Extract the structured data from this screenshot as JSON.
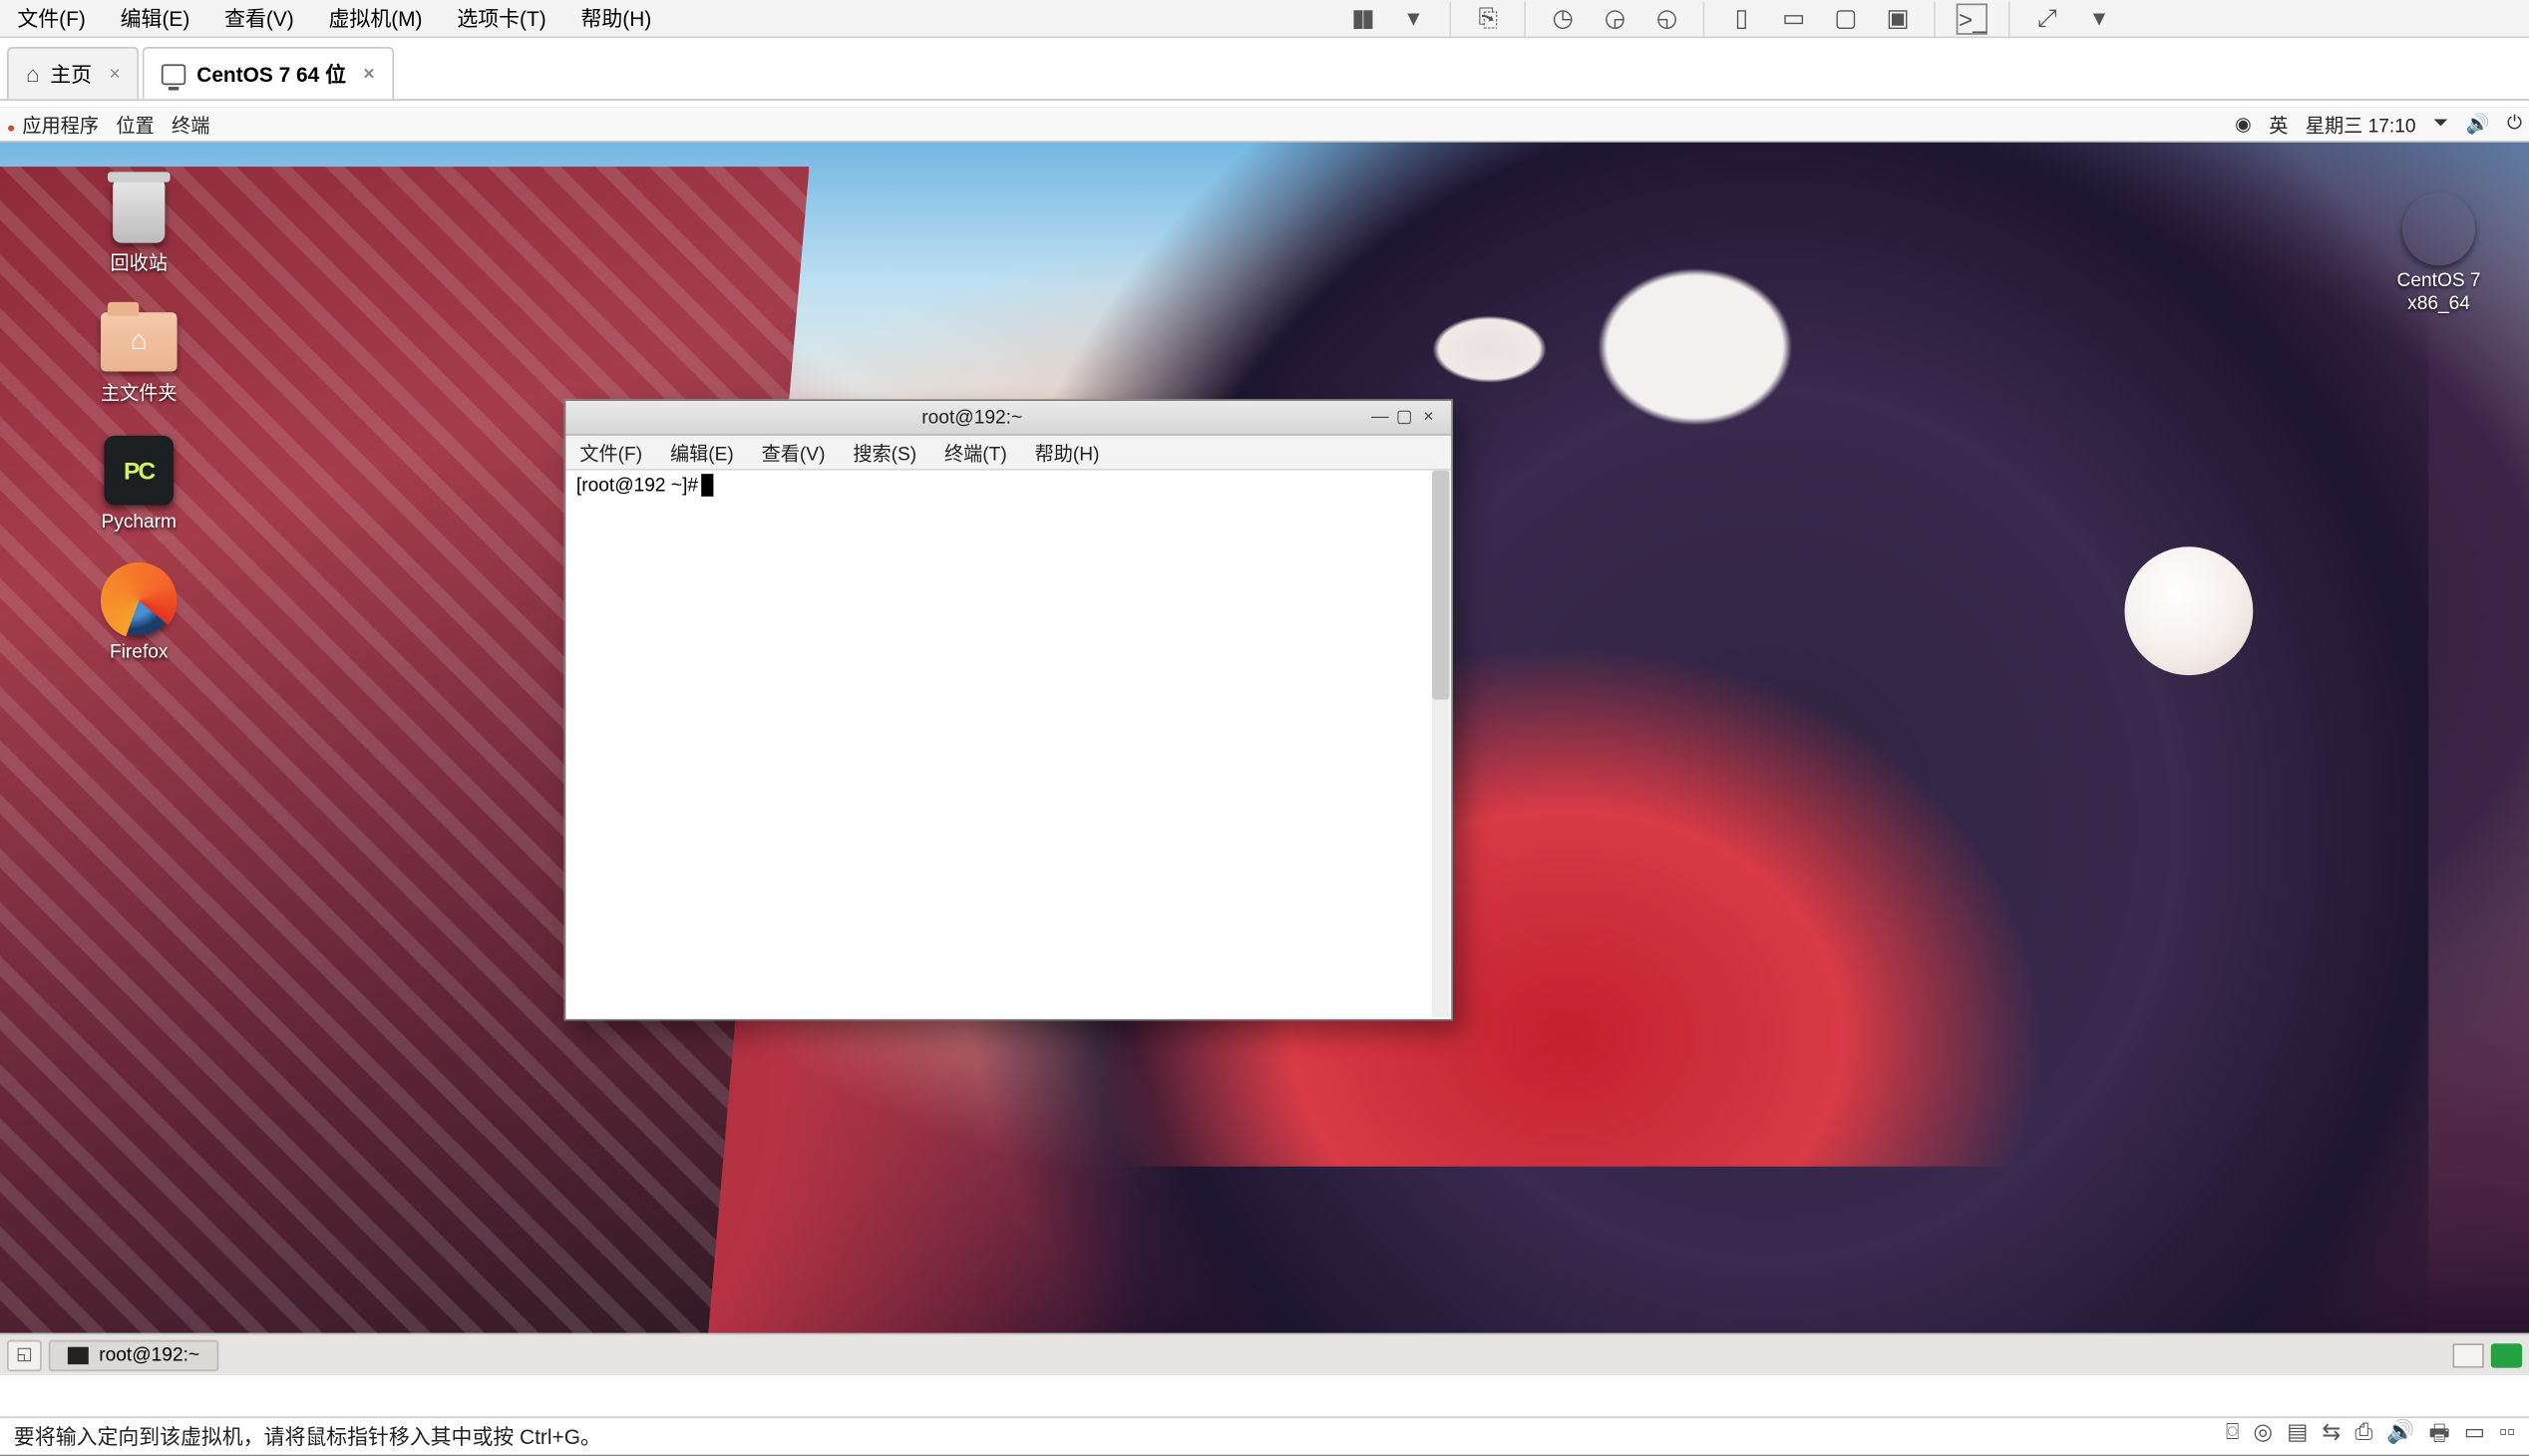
{
  "host": {
    "menu": {
      "file": "文件(F)",
      "edit": "编辑(E)",
      "view": "查看(V)",
      "vm": "虚拟机(M)",
      "tabs": "选项卡(T)",
      "help": "帮助(H)"
    },
    "tabs": {
      "home": "主页",
      "vmname": "CentOS 7 64 位"
    },
    "status_text": "要将输入定向到该虚拟机，请将鼠标指针移入其中或按 Ctrl+G。"
  },
  "guest": {
    "panel": {
      "apps": "应用程序",
      "places": "位置",
      "terminal": "终端",
      "ime": "英",
      "datetime": "星期三 17:10"
    },
    "desktop": {
      "trash": "回收站",
      "home": "主文件夹",
      "pycharm": "Pycharm",
      "firefox": "Firefox",
      "disc": "CentOS 7 x86_64"
    },
    "terminal": {
      "title": "root@192:~",
      "menu": {
        "file": "文件(F)",
        "edit": "编辑(E)",
        "view": "查看(V)",
        "search": "搜索(S)",
        "terminal": "终端(T)",
        "help": "帮助(H)"
      },
      "prompt": "[root@192 ~]#"
    },
    "taskbar": {
      "terminal_task": "root@192:~"
    }
  }
}
